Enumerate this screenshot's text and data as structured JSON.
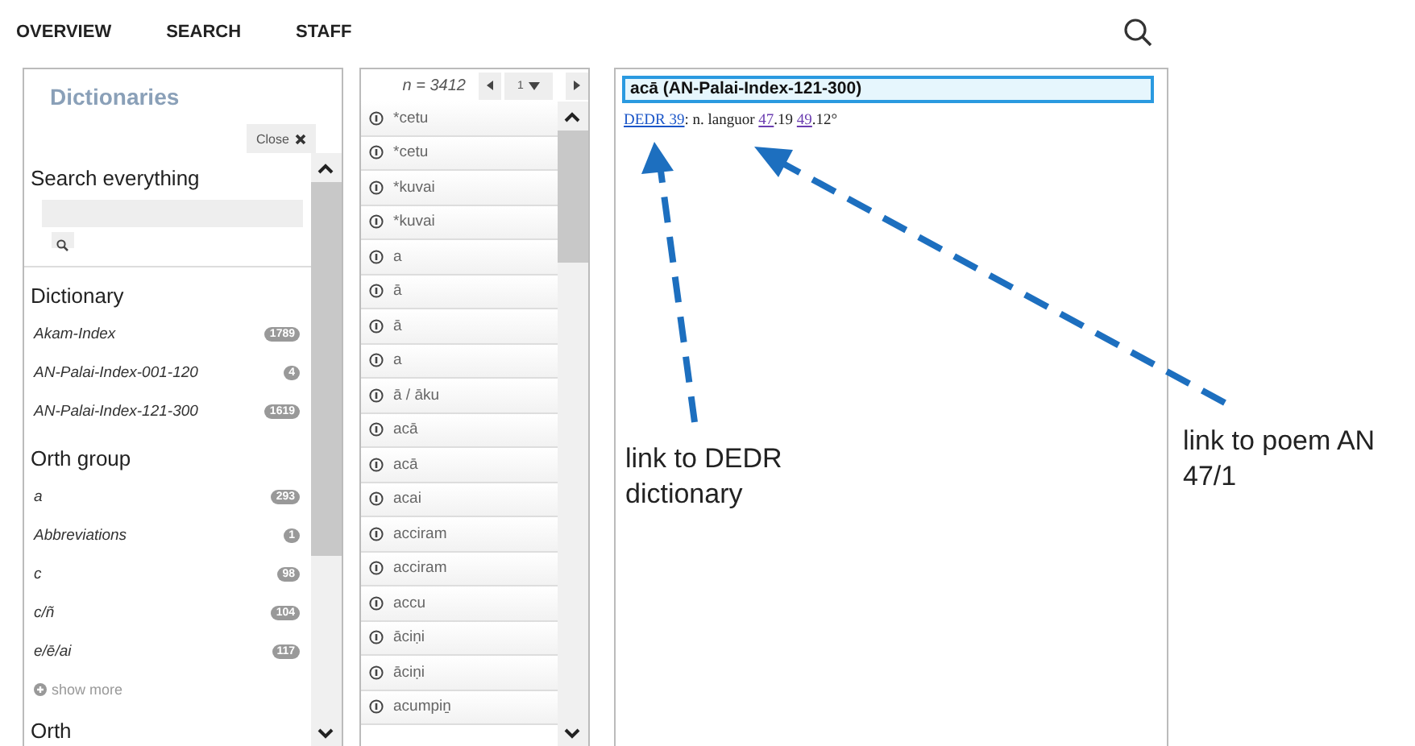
{
  "nav": {
    "items": [
      "OVERVIEW",
      "SEARCH",
      "STAFF"
    ]
  },
  "dictionaries_panel": {
    "title": "Dictionaries",
    "close_button": "Close",
    "search_heading": "Search everything",
    "facets": [
      {
        "heading": "Dictionary",
        "items": [
          {
            "label": "Akam-Index",
            "count": "1789"
          },
          {
            "label": "AN-Palai-Index-001-120",
            "count": "4"
          },
          {
            "label": "AN-Palai-Index-121-300",
            "count": "1619"
          }
        ]
      },
      {
        "heading": "Orth group",
        "items": [
          {
            "label": "a",
            "count": "293"
          },
          {
            "label": "Abbreviations",
            "count": "1"
          },
          {
            "label": "c",
            "count": "98"
          },
          {
            "label": "c/ñ",
            "count": "104"
          },
          {
            "label": "e/ē/ai",
            "count": "117"
          }
        ],
        "show_more": "show more"
      },
      {
        "heading": "Orth"
      }
    ]
  },
  "entry_list": {
    "count": "n = 3412",
    "page": "1",
    "items": [
      "*cetu",
      "*cetu",
      "*kuvai",
      "*kuvai",
      "a",
      "ā",
      "ā",
      "a",
      "ā / āku",
      "acā",
      "acā",
      "acai",
      "acciram",
      "acciram",
      "accu",
      "āciṇi",
      "āciṇi",
      "acumpiṉ"
    ]
  },
  "entry": {
    "title": "acā (AN-Palai-Index-121-300)",
    "segments": [
      {
        "kind": "link",
        "text": "DEDR 39",
        "visited": false
      },
      {
        "kind": "text",
        "text": ": n. languor "
      },
      {
        "kind": "link",
        "text": "47",
        "visited": true
      },
      {
        "kind": "text",
        "text": ".19 "
      },
      {
        "kind": "link",
        "text": "49",
        "visited": true
      },
      {
        "kind": "text",
        "text": ".12°"
      }
    ]
  },
  "annotations": [
    {
      "text": "link to DEDR dictionary"
    },
    {
      "text": "link to poem AN 47/1"
    }
  ]
}
